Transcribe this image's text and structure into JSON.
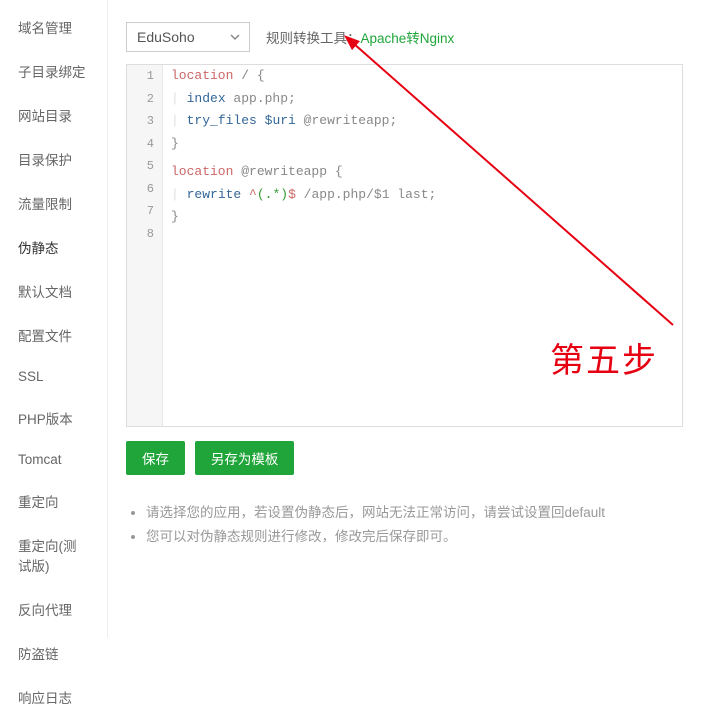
{
  "sidebar": {
    "items": [
      {
        "label": "域名管理"
      },
      {
        "label": "子目录绑定"
      },
      {
        "label": "网站目录"
      },
      {
        "label": "目录保护"
      },
      {
        "label": "流量限制"
      },
      {
        "label": "伪静态"
      },
      {
        "label": "默认文档"
      },
      {
        "label": "配置文件"
      },
      {
        "label": "SSL"
      },
      {
        "label": "PHP版本"
      },
      {
        "label": "Tomcat"
      },
      {
        "label": "重定向"
      },
      {
        "label": "重定向(测试版)"
      },
      {
        "label": "反向代理"
      },
      {
        "label": "防盗链"
      },
      {
        "label": "响应日志"
      }
    ],
    "activeIndex": 5
  },
  "toolbar": {
    "selectValue": "EduSoho",
    "labelText": "规则转换工具：",
    "linkText": "Apache转Nginx"
  },
  "code": {
    "lines": [
      {
        "n": "1",
        "parts": [
          {
            "cls": "tok-special",
            "t": "location"
          },
          {
            "cls": "tok-text",
            "t": " / {"
          }
        ]
      },
      {
        "n": "2",
        "parts": [
          {
            "cls": "indent-guide",
            "t": "|   "
          },
          {
            "cls": "tok-key",
            "t": "index"
          },
          {
            "cls": "tok-text",
            "t": " app.php;"
          }
        ]
      },
      {
        "n": "3",
        "parts": [
          {
            "cls": "indent-guide",
            "t": "|   "
          },
          {
            "cls": "tok-key",
            "t": "try_files"
          },
          {
            "cls": "tok-text",
            "t": " "
          },
          {
            "cls": "tok-var",
            "t": "$uri"
          },
          {
            "cls": "tok-text",
            "t": " @rewriteapp;"
          }
        ]
      },
      {
        "n": "4",
        "parts": [
          {
            "cls": "tok-text",
            "t": "}"
          }
        ]
      },
      {
        "n": "5",
        "parts": [
          {
            "cls": "",
            "t": " "
          }
        ]
      },
      {
        "n": "6",
        "parts": [
          {
            "cls": "tok-special",
            "t": "location"
          },
          {
            "cls": "tok-text",
            "t": " @rewriteapp {"
          }
        ]
      },
      {
        "n": "7",
        "parts": [
          {
            "cls": "indent-guide",
            "t": "|   "
          },
          {
            "cls": "tok-key",
            "t": "rewrite"
          },
          {
            "cls": "tok-text",
            "t": " "
          },
          {
            "cls": "tok-re",
            "t": "^"
          },
          {
            "cls": "tok-re2",
            "t": "(.*)"
          },
          {
            "cls": "tok-re",
            "t": "$"
          },
          {
            "cls": "tok-text",
            "t": " /app.php/$1 last;"
          }
        ]
      },
      {
        "n": "8",
        "parts": [
          {
            "cls": "tok-text",
            "t": "}"
          }
        ]
      }
    ]
  },
  "buttons": {
    "save": "保存",
    "saveAs": "另存为模板"
  },
  "tips": {
    "items": [
      "请选择您的应用，若设置伪静态后，网站无法正常访问，请尝试设置回default",
      "您可以对伪静态规则进行修改，修改完后保存即可。"
    ]
  },
  "annotation": {
    "stepText": "第五步",
    "arrowColor": "#e60012"
  }
}
